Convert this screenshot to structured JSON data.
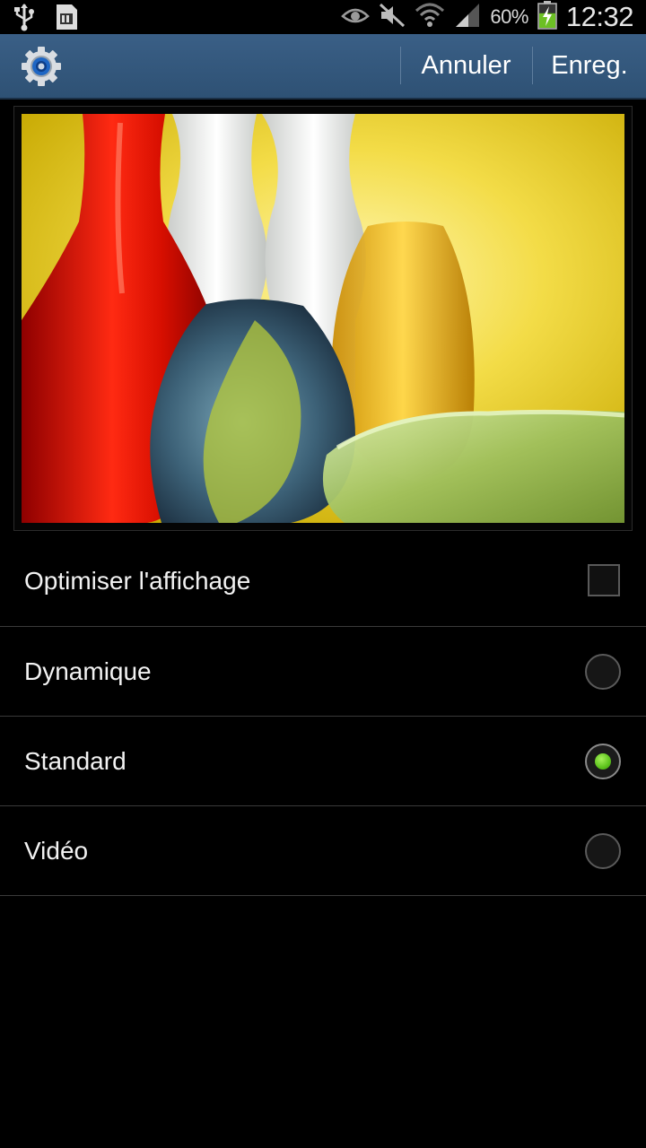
{
  "status_bar": {
    "icons_left": [
      "usb-icon",
      "sd-card-icon"
    ],
    "icons_right": [
      "eye-icon",
      "mute-icon",
      "wifi-icon",
      "signal-icon"
    ],
    "battery_percent": "60%",
    "battery_level": 0.6,
    "battery_charging": true,
    "time": "12:32"
  },
  "action_bar": {
    "app_icon": "settings-gear-icon",
    "cancel_label": "Annuler",
    "save_label": "Enreg.",
    "color": "#2f5276"
  },
  "options": {
    "optimize": {
      "label": "Optimiser l'affichage",
      "checked": false
    },
    "modes": [
      {
        "label": "Dynamique",
        "selected": false
      },
      {
        "label": "Standard",
        "selected": true
      },
      {
        "label": "Vidéo",
        "selected": false
      }
    ]
  },
  "colors": {
    "accent_green": "#5cc21c",
    "divider": "#3a3a3a"
  }
}
